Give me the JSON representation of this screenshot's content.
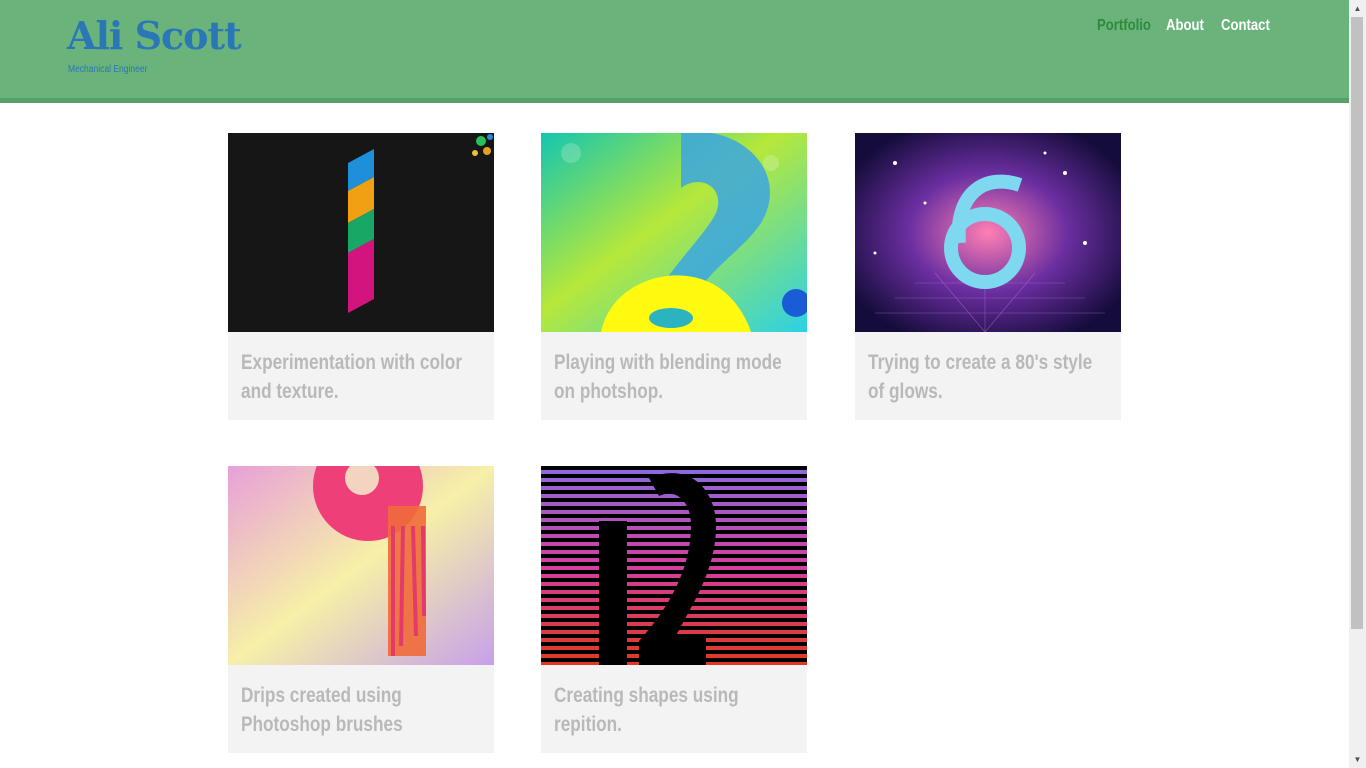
{
  "header": {
    "name": "Ali Scott",
    "tagline": "Mechanical Engineer",
    "nav": [
      {
        "label": "Portfolio",
        "active": true
      },
      {
        "label": "About",
        "active": false
      },
      {
        "label": "Contact",
        "active": false
      }
    ]
  },
  "portfolio": [
    {
      "caption": "Experimentation with color and texture.",
      "art": "vertical-stripe-number-1"
    },
    {
      "caption": "Playing with blending mode on photshop.",
      "art": "neon-number-2"
    },
    {
      "caption": "Trying to create a 80's style of glows.",
      "art": "retro-glow-number-6"
    },
    {
      "caption": "Drips created using Photoshop brushes",
      "art": "dripping-number-9"
    },
    {
      "caption": "Creating shapes using repition.",
      "art": "striped-number-12"
    }
  ],
  "colors": {
    "header_bg": "#6ab37a",
    "brand": "#2a77b8",
    "nav_active": "#2e8b3e",
    "caption_text": "#b9b9b9",
    "caption_bg": "#f3f3f3"
  }
}
